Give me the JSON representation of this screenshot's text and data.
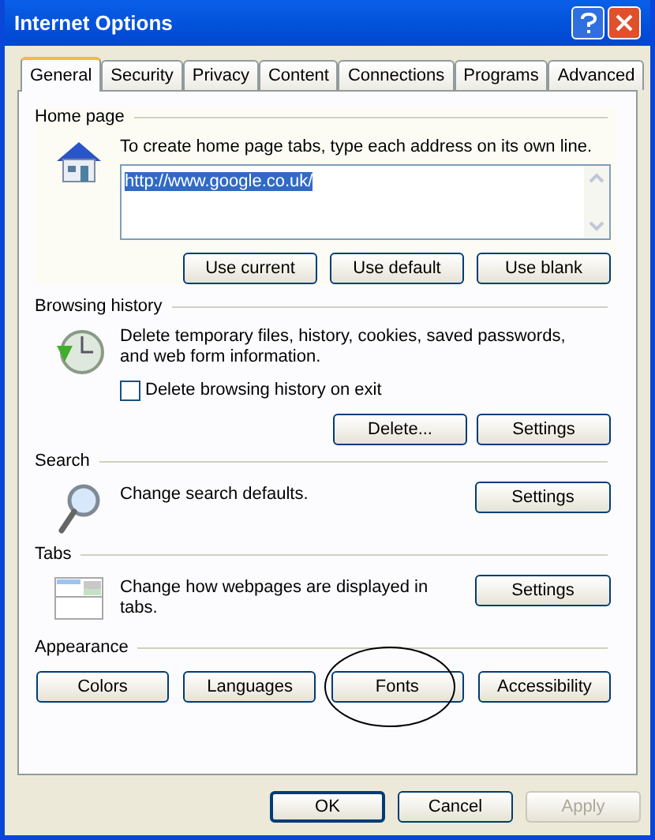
{
  "window": {
    "title": "Internet Options"
  },
  "tabs": [
    {
      "label": "General",
      "selected": true
    },
    {
      "label": "Security",
      "selected": false
    },
    {
      "label": "Privacy",
      "selected": false
    },
    {
      "label": "Content",
      "selected": false
    },
    {
      "label": "Connections",
      "selected": false
    },
    {
      "label": "Programs",
      "selected": false
    },
    {
      "label": "Advanced",
      "selected": false
    }
  ],
  "home_page": {
    "heading": "Home page",
    "description": "To create home page tabs, type each address on its own line.",
    "value": "http://www.google.co.uk/",
    "value_selected": true,
    "buttons": [
      "Use current",
      "Use default",
      "Use blank"
    ]
  },
  "browsing_history": {
    "heading": "Browsing history",
    "description": "Delete temporary files, history, cookies, saved passwords, and web form information.",
    "checkbox": {
      "label": "Delete browsing history on exit",
      "checked": false
    },
    "buttons": [
      "Delete...",
      "Settings"
    ]
  },
  "search": {
    "heading": "Search",
    "description": "Change search defaults.",
    "buttons": [
      "Settings"
    ]
  },
  "tabs_section": {
    "heading": "Tabs",
    "description": "Change how webpages are displayed in tabs.",
    "buttons": [
      "Settings"
    ]
  },
  "appearance": {
    "heading": "Appearance",
    "buttons": [
      {
        "label": "Colors",
        "circled": false
      },
      {
        "label": "Languages",
        "circled": false
      },
      {
        "label": "Fonts",
        "circled": true
      },
      {
        "label": "Accessibility",
        "circled": false
      }
    ]
  },
  "footer_buttons": [
    {
      "label": "OK",
      "default": true,
      "disabled": false
    },
    {
      "label": "Cancel",
      "default": false,
      "disabled": false
    },
    {
      "label": "Apply",
      "default": false,
      "disabled": true
    }
  ]
}
